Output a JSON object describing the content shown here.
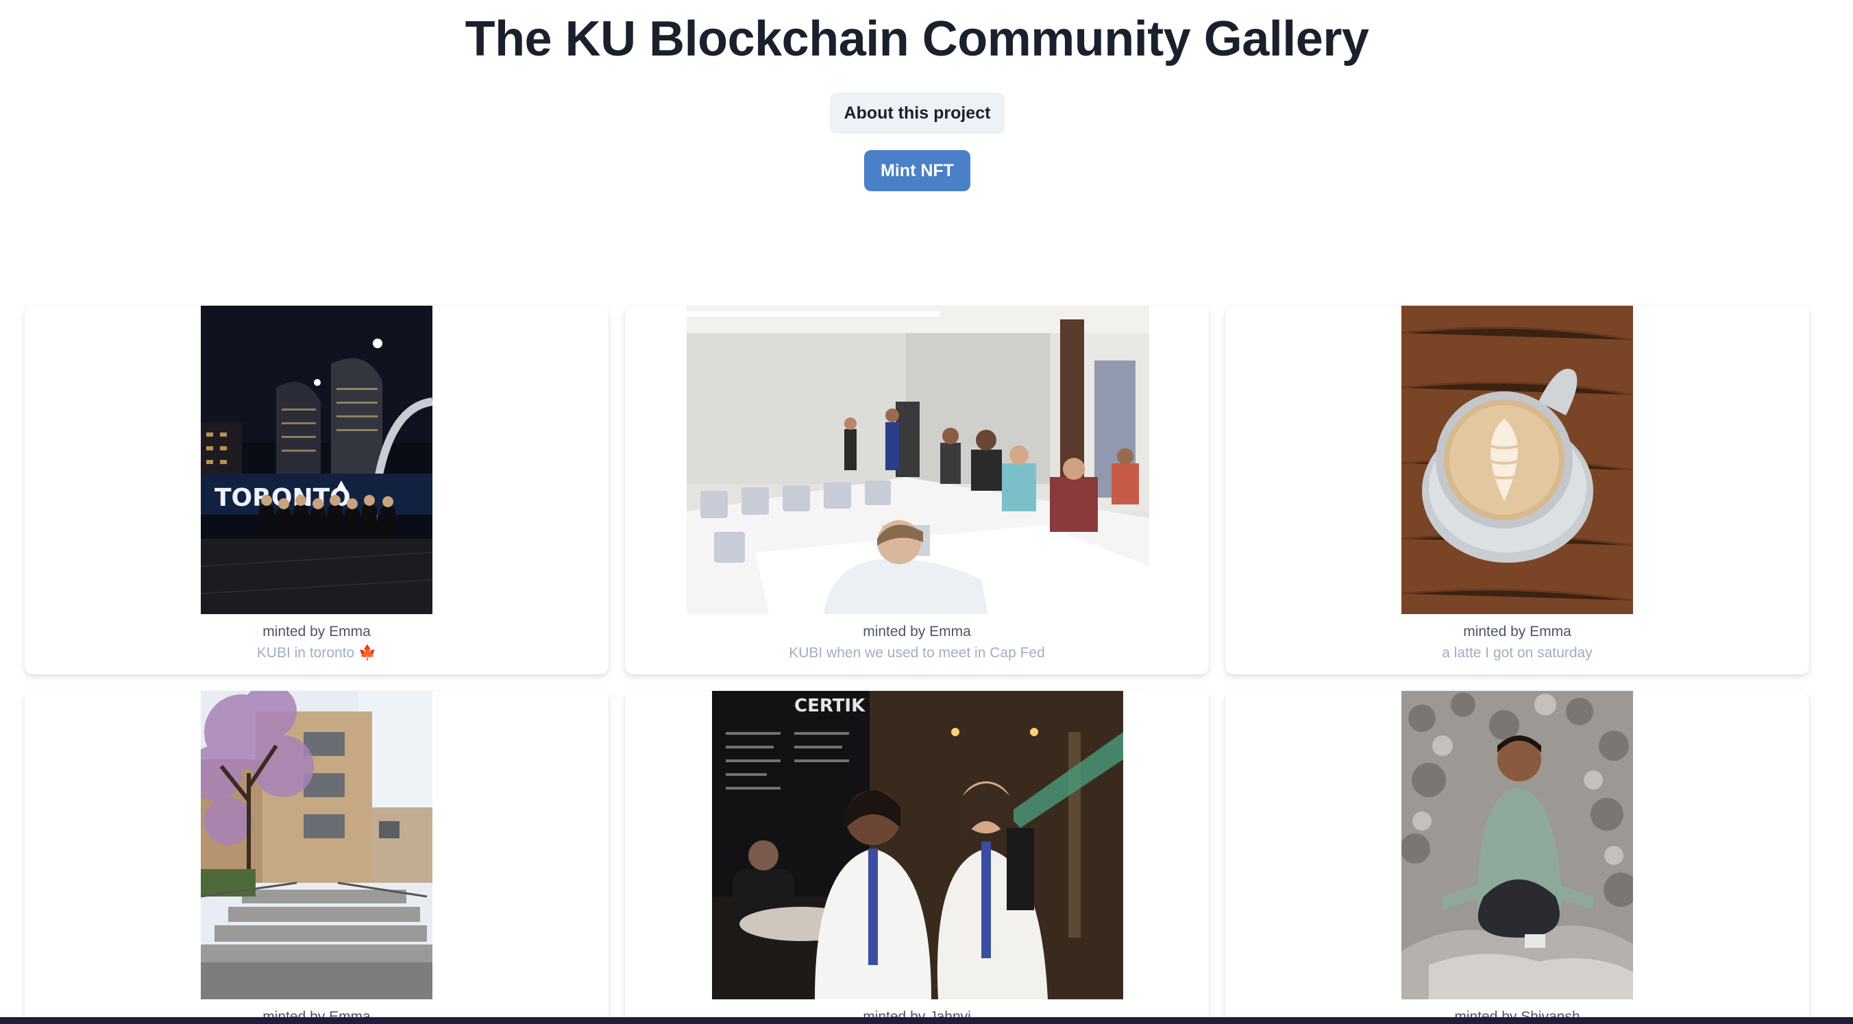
{
  "header": {
    "title": "The KU Blockchain Community Gallery"
  },
  "actions": {
    "about_label": "About this project",
    "mint_label": "Mint NFT"
  },
  "colors": {
    "mint_button": "#4a80c8",
    "about_button": "#edf2f7",
    "minted_text": "#4a5568",
    "caption_text": "#a0aec0"
  },
  "gallery": {
    "items": [
      {
        "minted_by": "minted by Emma",
        "caption": "KUBI in toronto 🍁",
        "photo_text": "TORONTO"
      },
      {
        "minted_by": "minted by Emma",
        "caption": "KUBI when we used to meet in Cap Fed"
      },
      {
        "minted_by": "minted by Emma",
        "caption": "a latte I got on saturday"
      },
      {
        "minted_by": "minted by Emma",
        "caption": ""
      },
      {
        "minted_by": "minted by Jahnvi",
        "caption": "",
        "photo_text": "CERTIK"
      },
      {
        "minted_by": "minted by Shivansh",
        "caption": ""
      }
    ]
  }
}
